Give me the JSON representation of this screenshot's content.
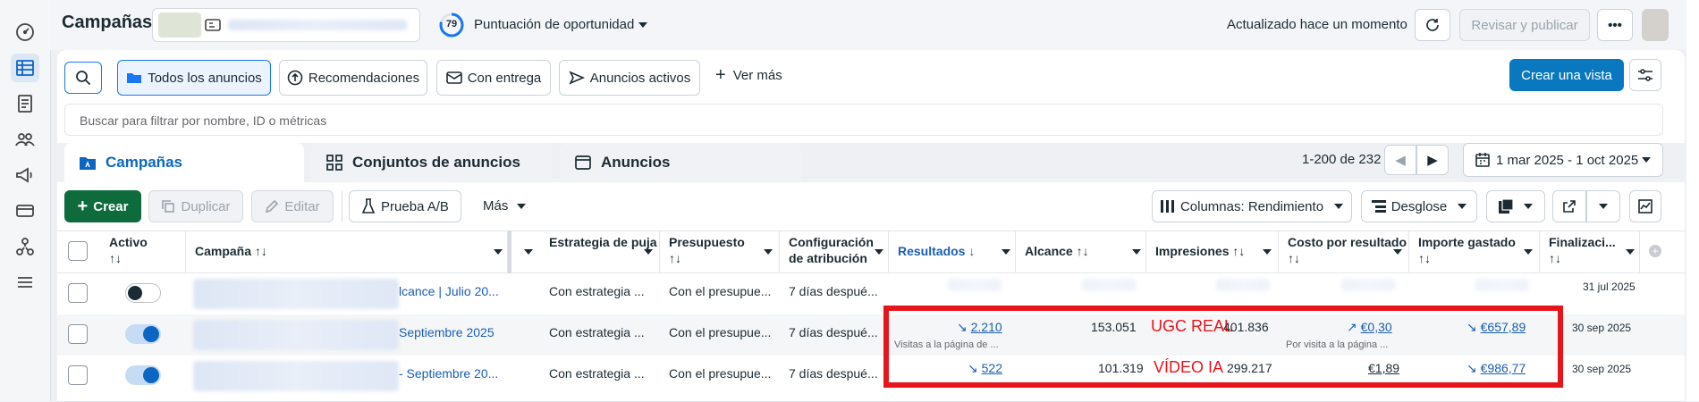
{
  "topbar": {
    "title": "Campañas",
    "score_value": "79",
    "score_label": "Puntuación de oportunidad",
    "updated": "Actualizado hace un momento",
    "review_publish": "Revisar y publicar"
  },
  "filters": {
    "all_ads": "Todos los anuncios",
    "recommendations": "Recomendaciones",
    "with_delivery": "Con entrega",
    "active_ads": "Anuncios activos",
    "see_more": "Ver más",
    "create_view": "Crear una vista",
    "search_placeholder": "Buscar para filtrar por nombre, ID o métricas"
  },
  "tabs": {
    "campaigns": "Campañas",
    "adsets": "Conjuntos de anuncios",
    "ads": "Anuncios"
  },
  "pagination": {
    "range": "1-200 de 232",
    "date_range": "1 mar 2025 - 1 oct 2025"
  },
  "toolbar": {
    "create": "Crear",
    "duplicate": "Duplicar",
    "edit": "Editar",
    "ab_test": "Prueba A/B",
    "more": "Más",
    "columns": "Columnas: Rendimiento",
    "breakdown": "Desglose"
  },
  "table": {
    "headers": {
      "active": "Activo",
      "campaign": "Campaña",
      "bid": "Estrategia de puja",
      "budget": "Presupuesto",
      "attribution": "Configuración de atribución",
      "results": "Resultados",
      "reach": "Alcance",
      "impressions": "Impresiones",
      "cost": "Costo por resultado",
      "spent": "Importe gastado",
      "end": "Finalizaci..."
    },
    "rows": [
      {
        "name": "lcance | Julio 20...",
        "bid": "Con estrategia ...",
        "budget": "Con el presupue...",
        "attribution": "7 días despué...",
        "end": "31 jul 2025"
      },
      {
        "name": "Septiembre 2025",
        "bid": "Con estrategia ...",
        "budget": "Con el presupue...",
        "attribution": "7 días despué...",
        "results": "2.210",
        "results_sub": "Visitas a la página de ...",
        "reach": "153.051",
        "annotation": "UGC REAL",
        "impressions": "401.836",
        "cost": "€0,30",
        "cost_sub": "Por visita a la página ...",
        "spent": "€657,89",
        "end": "30 sep 2025"
      },
      {
        "name": "- Septiembre 20...",
        "bid": "Con estrategia ...",
        "budget": "Con el presupue...",
        "attribution": "7 días despué...",
        "results": "522",
        "reach": "101.319",
        "annotation": "VÍDEO IA",
        "impressions": "299.217",
        "cost": "€1,89",
        "spent": "€986,77",
        "end": "30 sep 2025"
      }
    ]
  },
  "colors": {
    "accent": "#0a78be",
    "create_green": "#0d6b3c",
    "annotation_red": "#e8141c"
  }
}
